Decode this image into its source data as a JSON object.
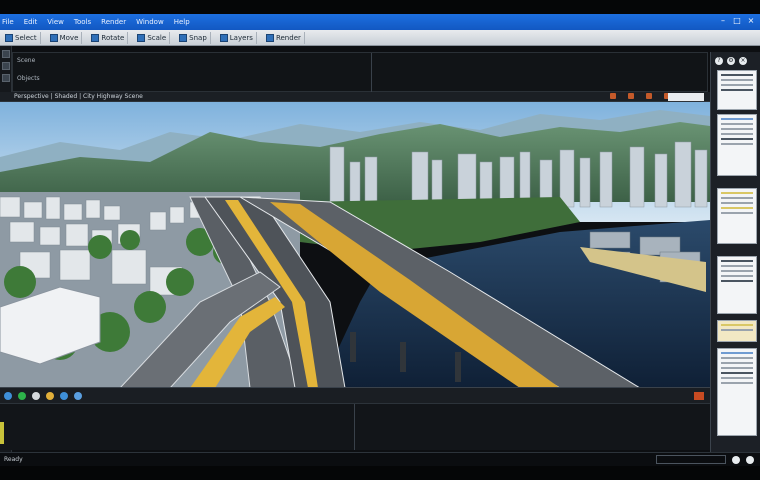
{
  "menubar": {
    "items": [
      "File",
      "Edit",
      "View",
      "Tools",
      "Render",
      "Window",
      "Help"
    ]
  },
  "toolbar": {
    "buttons": [
      "Select",
      "Move",
      "Rotate",
      "Scale",
      "Snap",
      "Layers",
      "Render"
    ]
  },
  "upper_pane": {
    "label_1": "Scene",
    "label_2": "Objects"
  },
  "viewport": {
    "header_text": "Perspective | Shaded | City Highway Scene"
  },
  "statusbar": {
    "left_text": "Ready",
    "right_text": ""
  },
  "colors": {
    "menubar": "#1d6fe0",
    "water": "#1a3552",
    "sky": "#a9cbe8",
    "mountain": "#4f7a5a",
    "road": "#53585e",
    "lane_yellow": "#e3b53a"
  },
  "icons": {
    "window": [
      "minimize-icon",
      "maximize-icon",
      "close-icon"
    ],
    "right_panel": [
      "help-icon",
      "settings-icon",
      "close-icon"
    ]
  }
}
